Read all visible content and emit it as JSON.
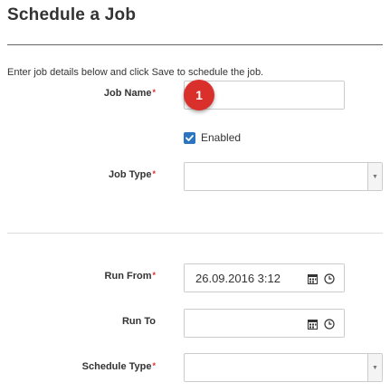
{
  "page": {
    "title": "Schedule a Job",
    "instructions": "Enter job details below and click Save to schedule the job."
  },
  "form": {
    "job_name": {
      "label": "Job Name",
      "required_mark": "*",
      "value": ""
    },
    "step_badge": "1",
    "enabled": {
      "label": "Enabled",
      "checked": true
    },
    "job_type": {
      "label": "Job Type",
      "required_mark": "*",
      "value": ""
    },
    "run_from": {
      "label": "Run From",
      "required_mark": "*",
      "value": "26.09.2016 3:12"
    },
    "run_to": {
      "label": "Run To",
      "value": ""
    },
    "schedule_type": {
      "label": "Schedule Type",
      "required_mark": "*",
      "value": ""
    }
  },
  "icons": {
    "calendar": "calendar-icon",
    "clock": "clock-icon",
    "dropdown": "chevron-down-icon",
    "check": "check-icon"
  },
  "colors": {
    "required": "#d9302c",
    "checkbox": "#2a74c0",
    "badge": "#d9302c"
  }
}
